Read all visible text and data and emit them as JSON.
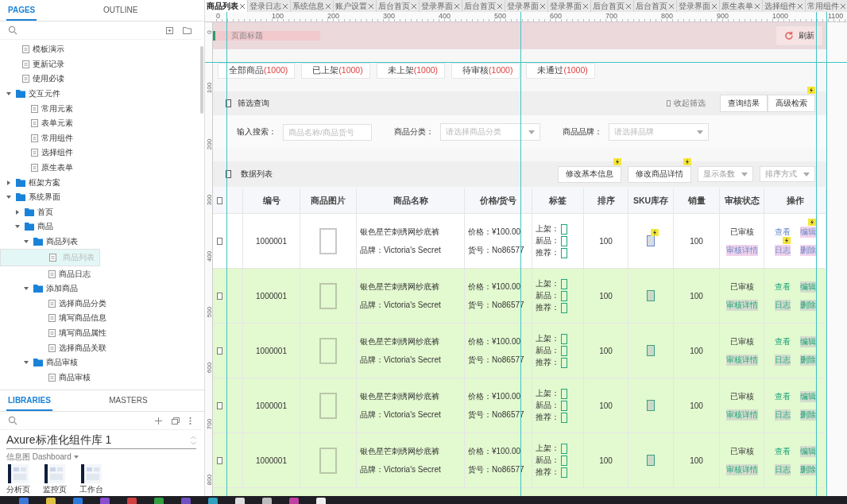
{
  "doc_tabs": [
    {
      "label": "商品列表",
      "selected": true
    },
    {
      "label": "登录日志",
      "selected": false
    },
    {
      "label": "系统信息",
      "selected": false
    },
    {
      "label": "账户设置",
      "selected": false
    },
    {
      "label": "后台首页",
      "selected": false
    },
    {
      "label": "登录界面",
      "selected": false
    },
    {
      "label": "后台首页",
      "selected": false
    },
    {
      "label": "登录界面",
      "selected": false
    },
    {
      "label": "登录界面",
      "selected": false
    },
    {
      "label": "后台首页",
      "selected": false
    },
    {
      "label": "后台首页",
      "selected": false
    },
    {
      "label": "登录界面",
      "selected": false
    },
    {
      "label": "原生表单",
      "selected": false
    },
    {
      "label": "选择组件",
      "selected": false
    },
    {
      "label": "常用组件",
      "selected": false
    }
  ],
  "ruler": {
    "x_ticks": [
      "0",
      "100",
      "200",
      "300",
      "400",
      "500",
      "600",
      "700",
      "800",
      "900",
      "1000",
      "1100"
    ],
    "y_ticks": [
      "0",
      "100",
      "200",
      "300",
      "400",
      "500",
      "600",
      "700",
      "800"
    ]
  },
  "pages_panel": {
    "tabs": [
      {
        "label": "PAGES",
        "selected": true
      },
      {
        "label": "OUTLINE",
        "selected": false
      }
    ],
    "tree": [
      {
        "label": "模板演示",
        "kind": "page",
        "selected": false
      },
      {
        "label": "更新记录",
        "kind": "page",
        "selected": false
      },
      {
        "label": "使用必读",
        "kind": "page",
        "selected": false
      },
      {
        "label": "交互元件",
        "kind": "folder",
        "expanded": true,
        "selected": false,
        "children": [
          {
            "label": "常用元素",
            "kind": "page",
            "selected": false
          },
          {
            "label": "表单元素",
            "kind": "page",
            "selected": false
          },
          {
            "label": "常用组件",
            "kind": "page",
            "selected": false
          },
          {
            "label": "选择组件",
            "kind": "page",
            "selected": false
          },
          {
            "label": "原生表单",
            "kind": "page",
            "selected": false
          }
        ]
      },
      {
        "label": "框架方案",
        "kind": "folder",
        "expanded": false,
        "selected": false
      },
      {
        "label": "系统界面",
        "kind": "folder",
        "expanded": true,
        "selected": false,
        "children": [
          {
            "label": "首页",
            "kind": "folder",
            "expanded": false,
            "selected": false
          },
          {
            "label": "商品",
            "kind": "folder",
            "expanded": true,
            "selected": false,
            "children": [
              {
                "label": "商品列表",
                "kind": "folder",
                "expanded": true,
                "selected": false,
                "children": [
                  {
                    "label": "商品列表",
                    "kind": "page",
                    "selected": true
                  },
                  {
                    "label": "商品日志",
                    "kind": "page",
                    "selected": false
                  }
                ]
              },
              {
                "label": "添加商品",
                "kind": "folder",
                "expanded": true,
                "selected": false,
                "children": [
                  {
                    "label": "选择商品分类",
                    "kind": "page",
                    "selected": false
                  },
                  {
                    "label": "填写商品信息",
                    "kind": "page",
                    "selected": false
                  },
                  {
                    "label": "填写商品属性",
                    "kind": "page",
                    "selected": false
                  },
                  {
                    "label": "选择商品关联",
                    "kind": "page",
                    "selected": false
                  }
                ]
              },
              {
                "label": "商品审核",
                "kind": "folder",
                "expanded": true,
                "selected": false,
                "children": [
                  {
                    "label": "商品审核",
                    "kind": "page",
                    "selected": false
                  }
                ]
              }
            ]
          }
        ]
      }
    ]
  },
  "libraries_panel": {
    "tabs": [
      {
        "label": "LIBRARIES",
        "selected": true
      },
      {
        "label": "MASTERS",
        "selected": false
      }
    ],
    "library": "Axure标准化组件库 1",
    "category": "信息图 Dashboard",
    "thumbnails": [
      {
        "label": "分析页"
      },
      {
        "label": "监控页"
      },
      {
        "label": "工作台"
      }
    ]
  },
  "page": {
    "title_placeholder": "页面标题",
    "refresh": "刷新",
    "status_tabs": [
      {
        "label": "全部商品",
        "count": "(1000)"
      },
      {
        "label": "已上架",
        "count": "(1000)"
      },
      {
        "label": "未上架",
        "count": "(1000)"
      },
      {
        "label": "待审核",
        "count": "(1000)"
      },
      {
        "label": "未通过",
        "count": "(1000)"
      }
    ],
    "filter": {
      "title": "筛选查询",
      "collapse": "收起筛选",
      "buttons": [
        {
          "label": "查询结果",
          "badge": false
        },
        {
          "label": "高级检索",
          "badge": true
        }
      ],
      "fields": [
        {
          "label": "输入搜索：",
          "placeholder": "商品名称/商品货号",
          "kind": "input"
        },
        {
          "label": "商品分类：",
          "placeholder": "请选择商品分类",
          "kind": "select"
        },
        {
          "label": "商品品牌：",
          "placeholder": "请选择品牌",
          "kind": "select"
        }
      ]
    },
    "list": {
      "title": "数据列表",
      "buttons": [
        {
          "label": "修改基本信息",
          "badge": true
        },
        {
          "label": "修改商品详情",
          "badge": true
        }
      ],
      "selects": [
        {
          "placeholder": "显示条数"
        },
        {
          "placeholder": "排序方式"
        }
      ]
    }
  },
  "table": {
    "header_checked": false,
    "columns": [
      "编号",
      "商品图片",
      "商品名称",
      "价格/货号",
      "标签",
      "排序",
      "SKU库存",
      "销量",
      "审核状态",
      "操作"
    ],
    "rows": [
      {
        "checked": false,
        "highlighted": false,
        "badges": true,
        "id": "1000001",
        "name": "银色星芒刺绣网纱底裤",
        "brand": "品牌：Victoria's Secret",
        "price": "价格：¥100.00",
        "code": "货号：No86577",
        "tags": [
          {
            "label": "上架：",
            "checked": false
          },
          {
            "label": "新品：",
            "checked": false
          },
          {
            "label": "推荐：",
            "checked": false
          }
        ],
        "sort": "100",
        "sales": "100",
        "status": "已审核",
        "status_link": "审核详情",
        "actions": [
          "查看",
          "编辑",
          "日志",
          "删除"
        ]
      },
      {
        "checked": false,
        "highlighted": true,
        "badges": false,
        "id": "1000001",
        "name": "银色星芒刺绣网纱底裤",
        "brand": "品牌：Victoria's Secret",
        "price": "价格：¥100.00",
        "code": "货号：No86577",
        "tags": [
          {
            "label": "上架：",
            "checked": false
          },
          {
            "label": "新品：",
            "checked": false
          },
          {
            "label": "推荐：",
            "checked": false
          }
        ],
        "sort": "100",
        "sales": "100",
        "status": "已审核",
        "status_link": "审核详情",
        "actions": [
          "查看",
          "编辑",
          "日志",
          "删除"
        ]
      },
      {
        "checked": false,
        "highlighted": true,
        "badges": false,
        "id": "1000001",
        "name": "银色星芒刺绣网纱底裤",
        "brand": "品牌：Victoria's Secret",
        "price": "价格：¥100.00",
        "code": "货号：No86577",
        "tags": [
          {
            "label": "上架：",
            "checked": false
          },
          {
            "label": "新品：",
            "checked": false
          },
          {
            "label": "推荐：",
            "checked": false
          }
        ],
        "sort": "100",
        "sales": "100",
        "status": "已审核",
        "status_link": "审核详情",
        "actions": [
          "查看",
          "编辑",
          "日志",
          "删除"
        ]
      },
      {
        "checked": false,
        "highlighted": true,
        "badges": false,
        "id": "1000001",
        "name": "银色星芒刺绣网纱底裤",
        "brand": "品牌：Victoria's Secret",
        "price": "价格：¥100.00",
        "code": "货号：No86577",
        "tags": [
          {
            "label": "上架：",
            "checked": false
          },
          {
            "label": "新品：",
            "checked": false
          },
          {
            "label": "推荐：",
            "checked": false
          }
        ],
        "sort": "100",
        "sales": "100",
        "status": "已审核",
        "status_link": "审核详情",
        "actions": [
          "查看",
          "编辑",
          "日志",
          "删除"
        ]
      },
      {
        "checked": false,
        "highlighted": true,
        "badges": false,
        "id": "1000001",
        "name": "银色星芒刺绣网纱底裤",
        "brand": "品牌：Victoria's Secret",
        "price": "价格：¥100.00",
        "code": "货号：No86577",
        "tags": [
          {
            "label": "上架：",
            "checked": false
          },
          {
            "label": "新品：",
            "checked": false
          },
          {
            "label": "推荐：",
            "checked": false
          }
        ],
        "sort": "100",
        "sales": "100",
        "status": "已审核",
        "status_link": "审核详情",
        "actions": [
          "查看",
          "编辑",
          "日志",
          "删除"
        ]
      }
    ]
  }
}
